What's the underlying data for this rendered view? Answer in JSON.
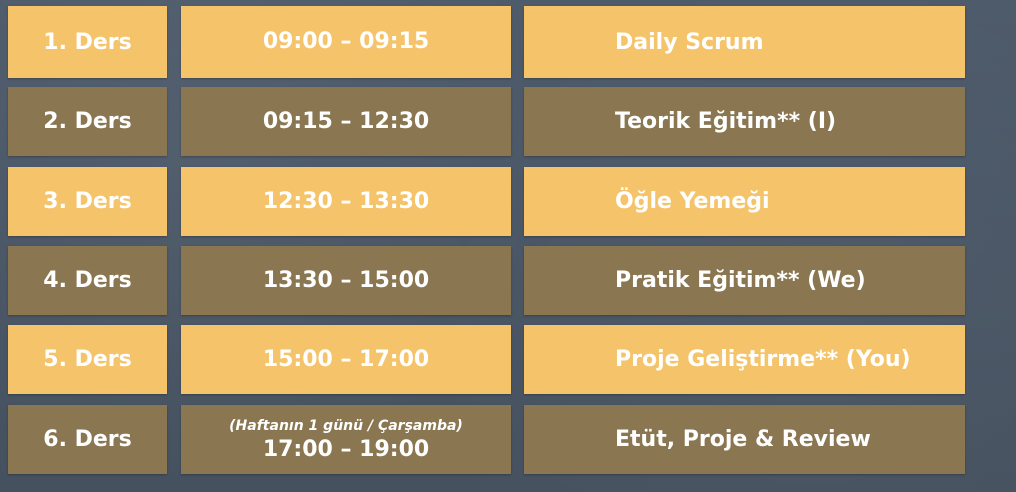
{
  "rows": [
    {
      "lesson": "1. Ders",
      "time": "09:00 – 09:15",
      "note": "",
      "activity": "Daily Scrum"
    },
    {
      "lesson": "2. Ders",
      "time": "09:15 – 12:30",
      "note": "",
      "activity": "Teorik Eğitim** (I)"
    },
    {
      "lesson": "3. Ders",
      "time": "12:30 – 13:30",
      "note": "",
      "activity": "Öğle Yemeği"
    },
    {
      "lesson": "4. Ders",
      "time": "13:30 – 15:00",
      "note": "",
      "activity": "Pratik Eğitim** (We)"
    },
    {
      "lesson": "5. Ders",
      "time": "15:00 – 17:00",
      "note": "",
      "activity": "Proje Geliştirme** (You)"
    },
    {
      "lesson": "6. Ders",
      "time": "17:00 – 19:00",
      "note": "(Haftanın 1 günü / Çarşamba)",
      "activity": "Etüt, Proje & Review"
    }
  ],
  "colors": {
    "yellow": "#f5c46a",
    "brown": "#8a7752",
    "background": "#4b5968"
  }
}
